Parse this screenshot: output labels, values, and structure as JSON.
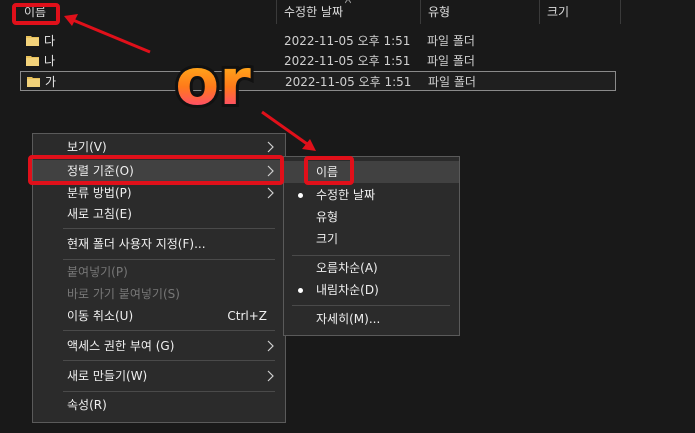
{
  "columns": {
    "name": "이름",
    "modified": "수정한 날짜",
    "type": "유형",
    "size": "크기"
  },
  "files": [
    {
      "name": "다",
      "modified": "2022-11-05 오후 1:51",
      "type": "파일 폴더"
    },
    {
      "name": "나",
      "modified": "2022-11-05 오후 1:51",
      "type": "파일 폴더"
    },
    {
      "name": "가",
      "modified": "2022-11-05 오후 1:51",
      "type": "파일 폴더"
    }
  ],
  "context_menu": {
    "view": "보기(V)",
    "sort_by": "정렬 기준(O)",
    "group_by": "분류 방법(P)",
    "refresh": "새로 고침(E)",
    "customize": "현재 폴더 사용자 지정(F)...",
    "paste": "붙여넣기(P)",
    "paste_shortcut": "바로 가기 붙여넣기(S)",
    "undo_move": "이동 취소(U)",
    "undo_shortcut": "Ctrl+Z",
    "give_access": "액세스 권한 부여 (G)",
    "new": "새로 만들기(W)",
    "properties": "속성(R)"
  },
  "sort_submenu": {
    "name": "이름",
    "date_modified": "수정한 날짜",
    "type": "유형",
    "size": "크기",
    "ascending": "오름차순(A)",
    "descending": "내림차순(D)",
    "more": "자세히(M)..."
  },
  "annotation": {
    "text": "or",
    "color": "#e0101a"
  },
  "colors": {
    "background": "#191919",
    "menu_bg": "#2b2b2b",
    "folder": "#e8c15a",
    "highlight": "#e0101a"
  }
}
